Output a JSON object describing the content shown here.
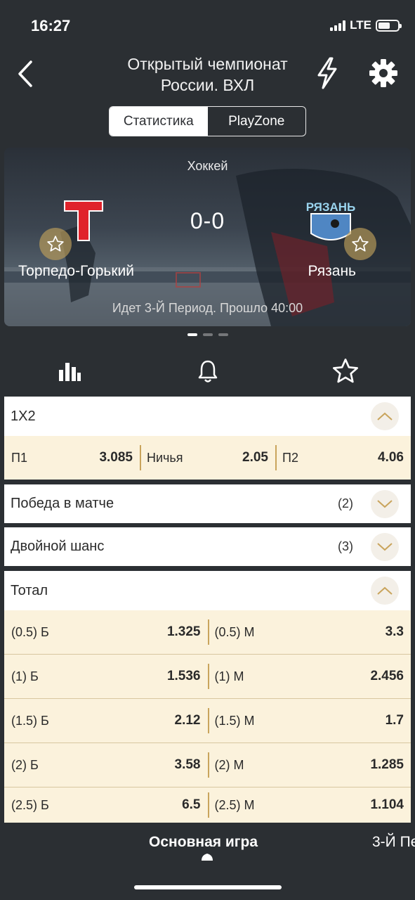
{
  "status": {
    "time": "16:27",
    "network": "LTE"
  },
  "header": {
    "title_line1": "Открытый чемпионат",
    "title_line2": "России. ВХЛ"
  },
  "segmented": {
    "stats": "Статистика",
    "playzone": "PlayZone"
  },
  "hero": {
    "sport": "Хоккей",
    "score": "0-0",
    "team_left": "Торпедо-Горький",
    "team_right": "Рязань",
    "period": "Идет 3-Й Период. Прошло 40:00",
    "logo_left_text": "T",
    "logo_right_text": "РЯЗАНЬ"
  },
  "markets": {
    "m1x2": {
      "title": "1X2",
      "odds": [
        {
          "label": "П1",
          "value": "3.085"
        },
        {
          "label": "Ничья",
          "value": "2.05"
        },
        {
          "label": "П2",
          "value": "4.06"
        }
      ]
    },
    "win": {
      "title": "Победа в матче",
      "count": "(2)"
    },
    "double": {
      "title": "Двойной шанс",
      "count": "(3)"
    },
    "total": {
      "title": "Тотал",
      "rows": [
        {
          "over_label": "(0.5) Б",
          "over_value": "1.325",
          "under_label": "(0.5) М",
          "under_value": "3.3"
        },
        {
          "over_label": "(1) Б",
          "over_value": "1.536",
          "under_label": "(1) М",
          "under_value": "2.456"
        },
        {
          "over_label": "(1.5) Б",
          "over_value": "2.12",
          "under_label": "(1.5) М",
          "under_value": "1.7"
        },
        {
          "over_label": "(2) Б",
          "over_value": "3.58",
          "under_label": "(2) М",
          "under_value": "1.285"
        },
        {
          "over_label": "(2.5) Б",
          "over_value": "6.5",
          "under_label": "(2.5) М",
          "under_value": "1.104"
        }
      ]
    }
  },
  "bottom_tabs": {
    "main": "Основная игра",
    "next": "3-Й Пе"
  },
  "colors": {
    "accent": "#c9a45c",
    "odds_bg": "#fbf2dc",
    "bg": "#2b2f33"
  }
}
